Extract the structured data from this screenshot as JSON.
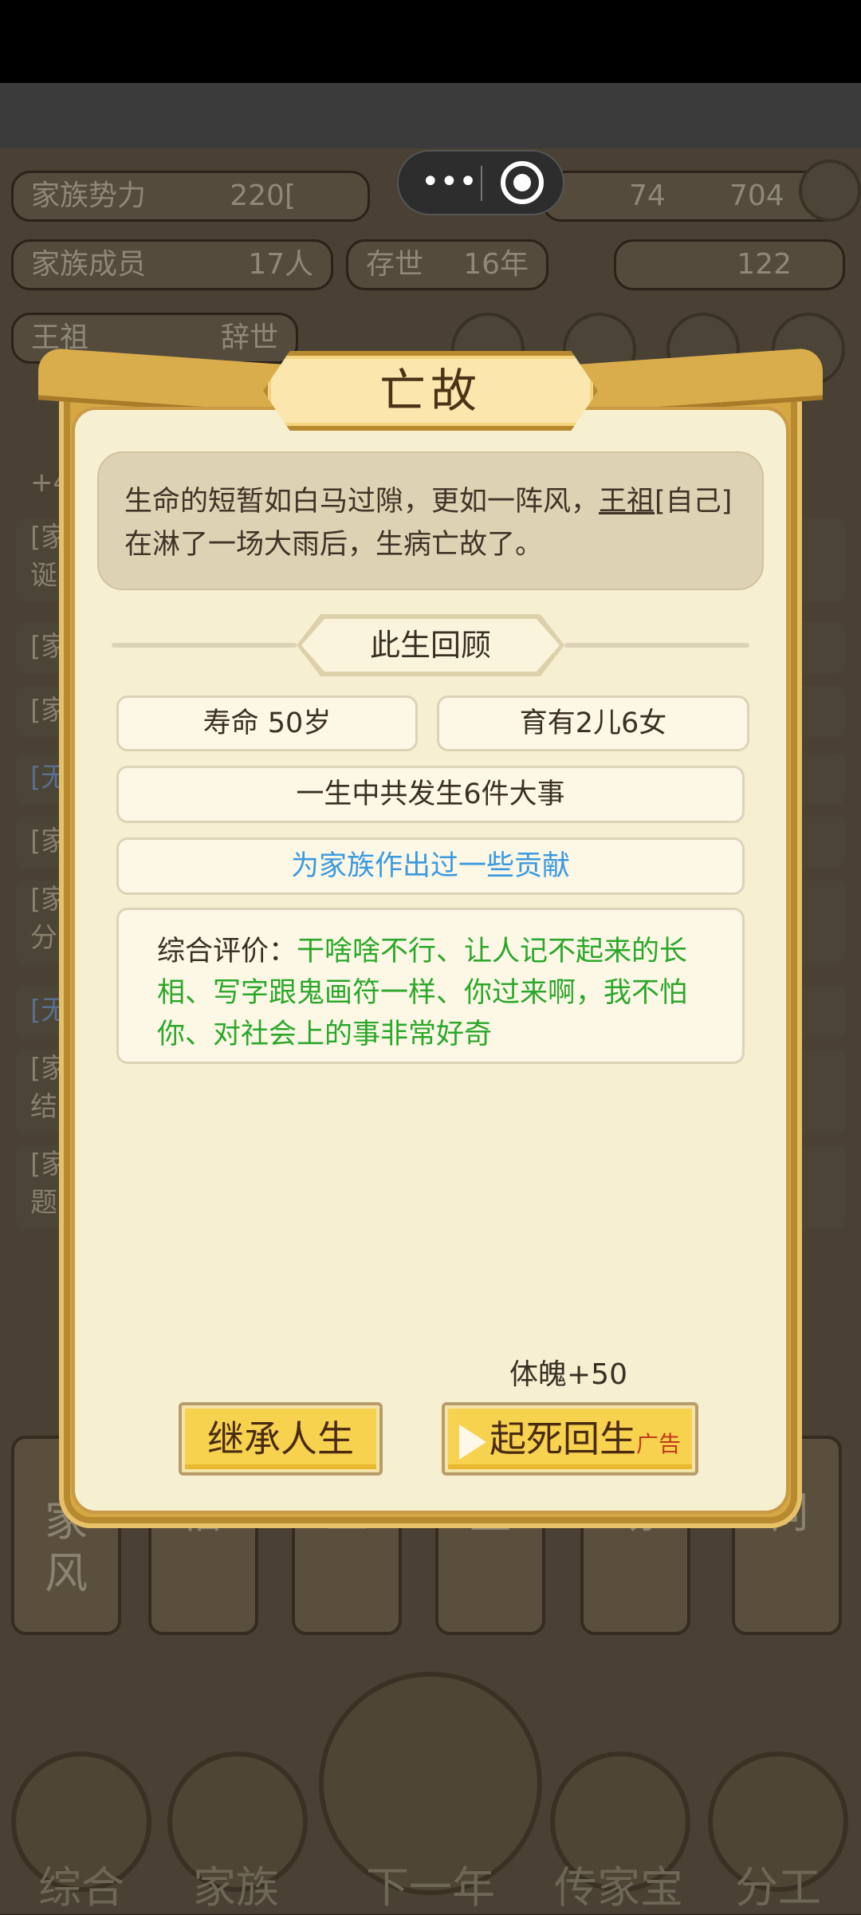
{
  "top_stats": {
    "family_power_label": "家族势力",
    "family_power_value": "220[",
    "coins_left": "74",
    "coins_right": "704",
    "family_members_label": "家族成员",
    "family_members_value": "17人",
    "survived_label": "存世",
    "survived_value": "16年",
    "gold_value": "122",
    "person_name": "王祖",
    "person_status": "辞世"
  },
  "bg_log_rows": [
    "+4",
    "[家",
    "诞",
    "[家",
    "[家",
    "[无",
    "[家",
    "[家",
    "分",
    "[无",
    "[家",
    "结",
    "[家",
    "题"
  ],
  "bottom_tabs": [
    "家\n风",
    "俗",
    "业",
    "堂",
    "场",
    "祠"
  ],
  "bottom_nav": [
    "综合",
    "家族",
    "下一年",
    "传家宝",
    "分工"
  ],
  "dialog": {
    "title": "亡故",
    "description_pre": "生命的短暂如白马过隙，更如一阵风，",
    "description_name": "王祖",
    "description_post": "[自己]在淋了一场大雨后，生病亡故了。",
    "section_title": "此生回顾",
    "lifespan": "寿命 50岁",
    "children": "育有2儿6女",
    "events": "一生中共发生6件大事",
    "contribution": "为家族作出过一些贡献",
    "evaluation_label": "综合评价：",
    "evaluation_text": "干啥啥不行、让人记不起来的长相、写字跟鬼画符一样、你过来啊，我不怕你、对社会上的事非常好奇",
    "bonus": "体魄+50",
    "inherit_button": "继承人生",
    "revive_button": "起死回生",
    "ad_tag": "广告"
  },
  "colors": {
    "contribution_text": "#3a9ae0",
    "evaluation_text": "#2ba82b",
    "button_gold": "#f7d24f"
  }
}
